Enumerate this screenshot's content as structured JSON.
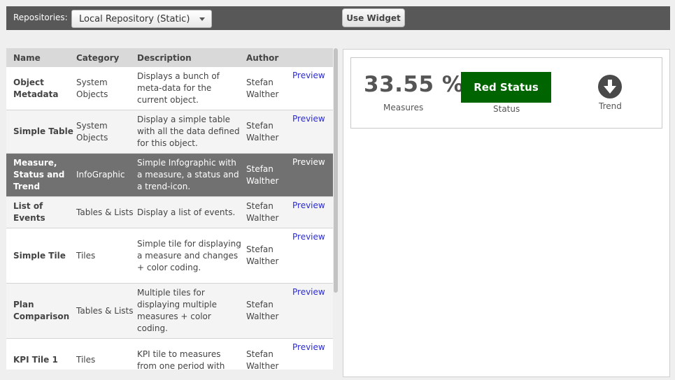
{
  "toolbar": {
    "repo_label": "Repositories:",
    "repo_selected": "Local Repository (Static)",
    "use_widget_label": "Use Widget"
  },
  "list": {
    "headers": {
      "name": "Name",
      "category": "Category",
      "description": "Description",
      "author": "Author"
    },
    "rows": [
      {
        "name": "Object Metadata",
        "category": "System Objects",
        "description": "Displays a bunch of meta-data for the current object.",
        "author": "Stefan Walther",
        "preview": "Preview"
      },
      {
        "name": "Simple Table",
        "category": "System Objects",
        "description": "Display a simple table with all the data defined for this object.",
        "author": "Stefan Walther",
        "preview": "Preview"
      },
      {
        "name": "Measure, Status and Trend",
        "category": "InfoGraphic",
        "description": "Simple Infographic with a measure, a status and a trend-icon.",
        "author": "Stefan Walther",
        "preview": "Preview"
      },
      {
        "name": "List of Events",
        "category": "Tables & Lists",
        "description": "Display a list of events.",
        "author": "Stefan Walther",
        "preview": "Preview"
      },
      {
        "name": "Simple Tile",
        "category": "Tiles",
        "description": "Simple tile for displaying a measure and changes + color coding.",
        "author": "Stefan Walther",
        "preview": "Preview"
      },
      {
        "name": "Plan Comparison",
        "category": "Tables & Lists",
        "description": "Multiple tiles for displaying multiple measures + color coding.",
        "author": "Stefan Walther",
        "preview": "Preview"
      },
      {
        "name": "KPI Tile 1",
        "category": "Tiles",
        "description": "KPI tile to measures from one period with",
        "author": "Stefan Walther",
        "preview": "Preview"
      }
    ]
  },
  "preview": {
    "measure_value": "33.55 %",
    "measure_label": "Measures",
    "status_text": "Red Status",
    "status_label": "Status",
    "status_color": "#006400",
    "trend_icon": "arrow-down-circle-icon",
    "trend_label": "Trend"
  }
}
